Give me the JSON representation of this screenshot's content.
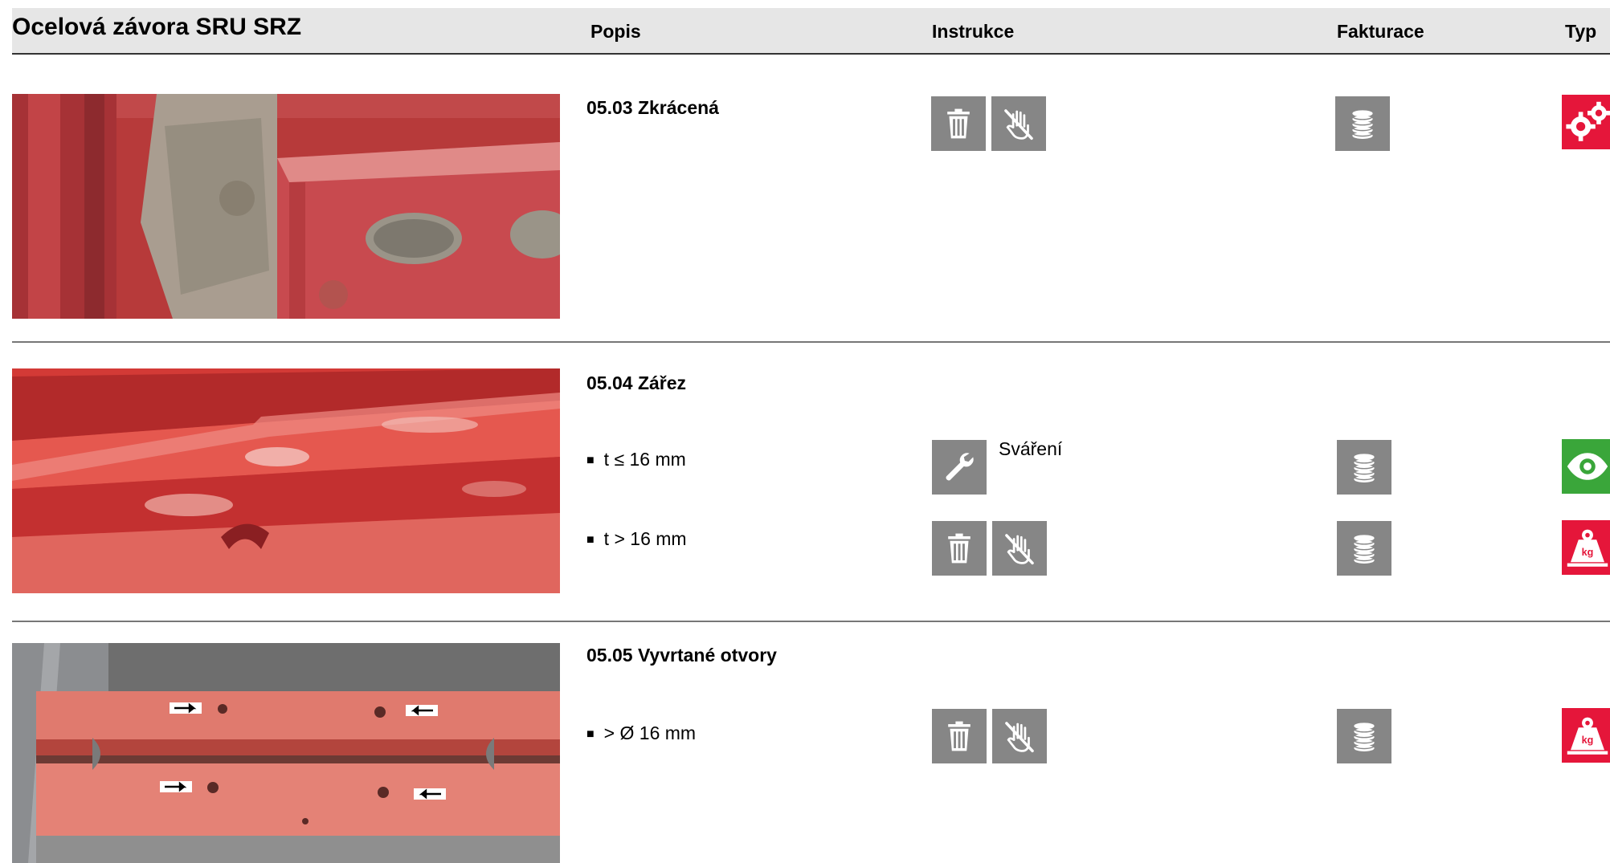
{
  "header": {
    "title": "Ocelová závora SRU SRZ",
    "col_popis": "Popis",
    "col_instrukce": "Instrukce",
    "col_fakturace": "Fakturace",
    "col_typ": "Typ"
  },
  "sections": [
    {
      "title": "05.03 Zkrácená",
      "rows": [
        {
          "condition": "",
          "instructions": [
            "trash-icon",
            "no-hand-icon"
          ],
          "billing": "coins-icon",
          "type": "gears-icon"
        }
      ]
    },
    {
      "title": "05.04 Zářez",
      "rows": [
        {
          "condition": "t ≤ 16 mm",
          "instructions": [
            "wrench-icon"
          ],
          "instruction_label": "Sváření",
          "billing": "coins-icon",
          "type": "eye-icon"
        },
        {
          "condition": "t > 16 mm",
          "instructions": [
            "trash-icon",
            "no-hand-icon"
          ],
          "billing": "coins-icon",
          "type": "weight-icon"
        }
      ]
    },
    {
      "title": "05.05 Vyvrtané otvory",
      "rows": [
        {
          "condition": "> Ø 16 mm",
          "instructions": [
            "trash-icon",
            "no-hand-icon"
          ],
          "billing": "coins-icon",
          "type": "weight-icon"
        }
      ]
    }
  ],
  "bullet": "■",
  "colors": {
    "icon_gray": "#868686",
    "type_red": "#e5163a",
    "type_green": "#3aa63a",
    "header_bg": "#e6e6e6"
  }
}
